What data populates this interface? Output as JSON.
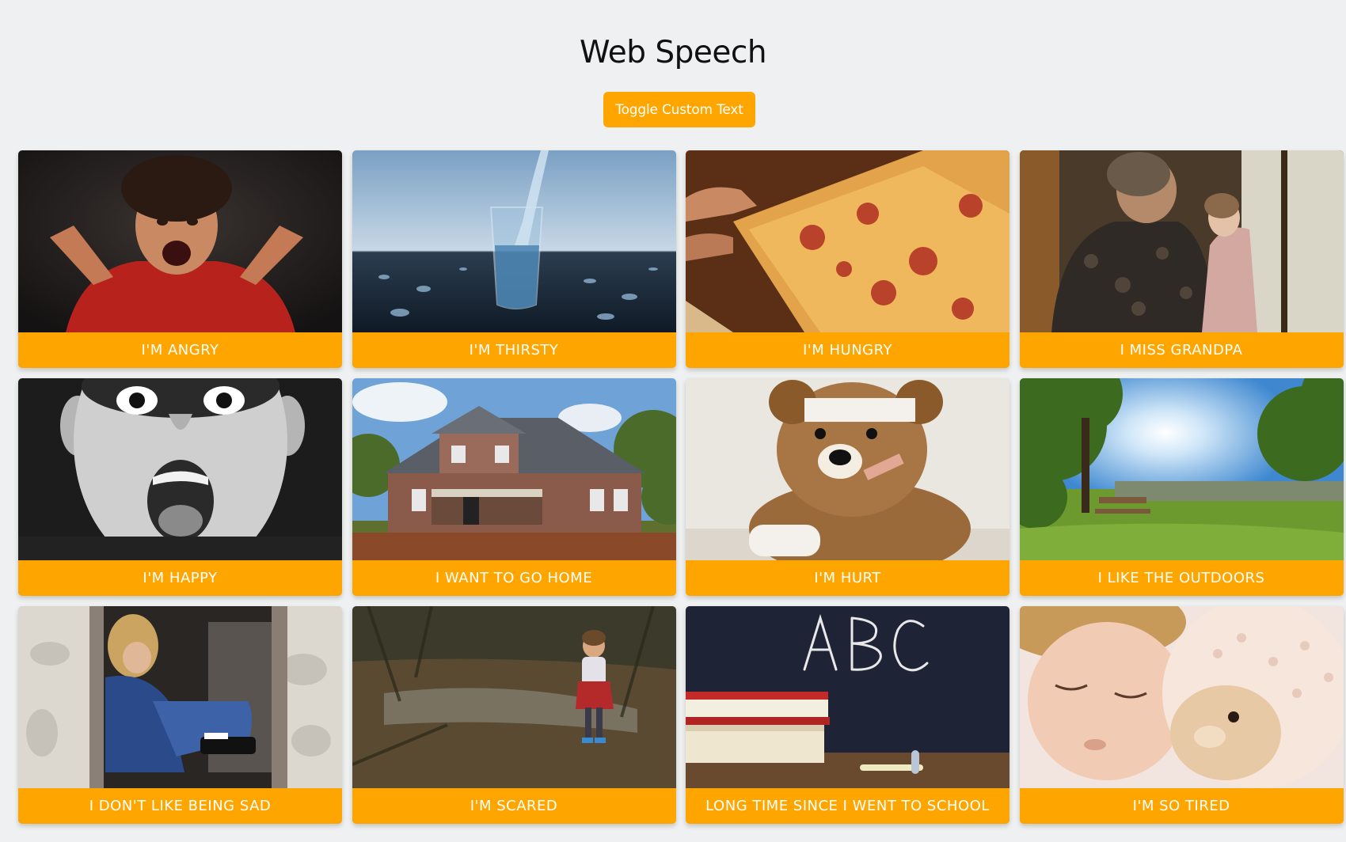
{
  "header": {
    "title": "Web Speech",
    "toggle_label": "Toggle Custom Text"
  },
  "colors": {
    "background": "#eef0f1",
    "accent": "#ffa500",
    "caption_text": "#ffffff"
  },
  "cards": [
    {
      "label": "I'M ANGRY",
      "image": "angry-child-photo"
    },
    {
      "label": "I'M THIRSTY",
      "image": "glass-of-water-photo"
    },
    {
      "label": "I'M HUNGRY",
      "image": "pizza-slice-photo"
    },
    {
      "label": "I MISS GRANDPA",
      "image": "grandparent-and-child-photo"
    },
    {
      "label": "I'M HAPPY",
      "image": "excited-boy-photo"
    },
    {
      "label": "I WANT TO GO HOME",
      "image": "house-photo"
    },
    {
      "label": "I'M HURT",
      "image": "bandaged-teddy-bear-photo"
    },
    {
      "label": "I LIKE THE OUTDOORS",
      "image": "park-lake-photo"
    },
    {
      "label": "I DON'T LIKE BEING SAD",
      "image": "sad-child-doorway-photo"
    },
    {
      "label": "I'M SCARED",
      "image": "child-in-woods-photo"
    },
    {
      "label": "LONG TIME SINCE I WENT TO SCHOOL",
      "image": "chalkboard-abc-photo"
    },
    {
      "label": "I'M SO TIRED",
      "image": "sleeping-child-photo"
    }
  ]
}
